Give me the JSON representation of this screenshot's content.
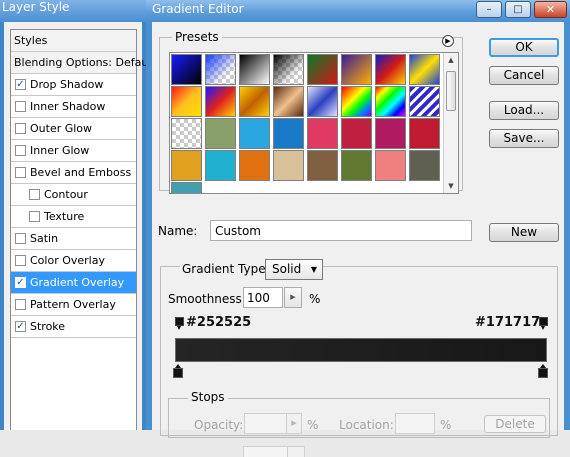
{
  "layer_style": {
    "title": "Layer Style",
    "header": "Styles",
    "blending": "Blending Options: Default",
    "items": [
      {
        "label": "Drop Shadow",
        "checked": true,
        "indent": false,
        "selected": false
      },
      {
        "label": "Inner Shadow",
        "checked": false,
        "indent": false,
        "selected": false
      },
      {
        "label": "Outer Glow",
        "checked": false,
        "indent": false,
        "selected": false
      },
      {
        "label": "Inner Glow",
        "checked": false,
        "indent": false,
        "selected": false
      },
      {
        "label": "Bevel and Emboss",
        "checked": false,
        "indent": false,
        "selected": false
      },
      {
        "label": "Contour",
        "checked": false,
        "indent": true,
        "selected": false
      },
      {
        "label": "Texture",
        "checked": false,
        "indent": true,
        "selected": false
      },
      {
        "label": "Satin",
        "checked": false,
        "indent": false,
        "selected": false
      },
      {
        "label": "Color Overlay",
        "checked": false,
        "indent": false,
        "selected": false
      },
      {
        "label": "Gradient Overlay",
        "checked": true,
        "indent": false,
        "selected": true
      },
      {
        "label": "Pattern Overlay",
        "checked": false,
        "indent": false,
        "selected": false
      },
      {
        "label": "Stroke",
        "checked": true,
        "indent": false,
        "selected": false
      }
    ]
  },
  "gradient_editor": {
    "title": "Gradient Editor",
    "window_buttons": {
      "minimize": "–",
      "maximize": "□",
      "close": "✕"
    },
    "presets_label": "Presets",
    "presets": [
      "linear-gradient(135deg,#1a1aff,#000)",
      "linear-gradient(135deg,#1a3cff,rgba(255,255,255,0) 70%),repeating-conic-gradient(#ccc 0 25%,#fff 0 50%) 0 0/8px 8px",
      "linear-gradient(135deg,#000,#fff)",
      "linear-gradient(135deg,#000,rgba(255,255,255,0) 70%),repeating-conic-gradient(#ccc 0 25%,#fff 0 50%) 0 0/8px 8px",
      "linear-gradient(135deg,#0a7a2a,#d01818)",
      "linear-gradient(135deg,#3b1a9a,#ffb000)",
      "linear-gradient(135deg,#1020c0,#d01818,#ffd000)",
      "linear-gradient(135deg,#1a40e0,#ffe000,#1a40e0)",
      "linear-gradient(135deg,#ff1818,#ffc020,#ffe000)",
      "linear-gradient(135deg,#1a1aff,#e02020,#ffd000)",
      "linear-gradient(135deg,#ffd000,#c06000,#ffd000)",
      "linear-gradient(135deg,#5a2a10,#f0c090,#5a2a10)",
      "linear-gradient(135deg,#e0e0ff,#2a40c0,#e0e0ff)",
      "linear-gradient(135deg,#ff0000,#ff8000,#ffff00,#00ff00,#0080ff,#8000ff)",
      "linear-gradient(135deg,#ff0000,#ffff00,#00ff00,#00ffff,#0000ff,#ff00ff)",
      "repeating-linear-gradient(135deg,#2a2ad0 0 4px,#fff 4px 7px)",
      "repeating-conic-gradient(#ccc 0 25%,#fff 0 50%) 0 0/8px 8px",
      "#8aa06a",
      "#2aa6e0",
      "#1a7ac8",
      "#e03a64",
      "#c02040",
      "#b01a60",
      "#c01a30",
      "#e0a020",
      "#20b0d0",
      "#e07010",
      "#d8c098",
      "#806040",
      "#607830",
      "#f08080",
      "#606050",
      "#40a0b0"
    ],
    "scroll_up": "▲",
    "scroll_down": "▼",
    "buttons": {
      "ok": "OK",
      "cancel": "Cancel",
      "load": "Load...",
      "save": "Save...",
      "new": "New"
    },
    "name_label": "Name:",
    "name_value": "Custom",
    "gradient_type_label": "Gradient Type:",
    "gradient_type_value": "Solid",
    "smoothness_label": "Smoothness:",
    "smoothness_value": "100",
    "percent": "%",
    "stop_left_color": "#252525",
    "stop_right_color": "#171717",
    "stops_label": "Stops",
    "opacity_label": "Opacity:",
    "location_label": "Location:",
    "delete_label": "Delete"
  }
}
